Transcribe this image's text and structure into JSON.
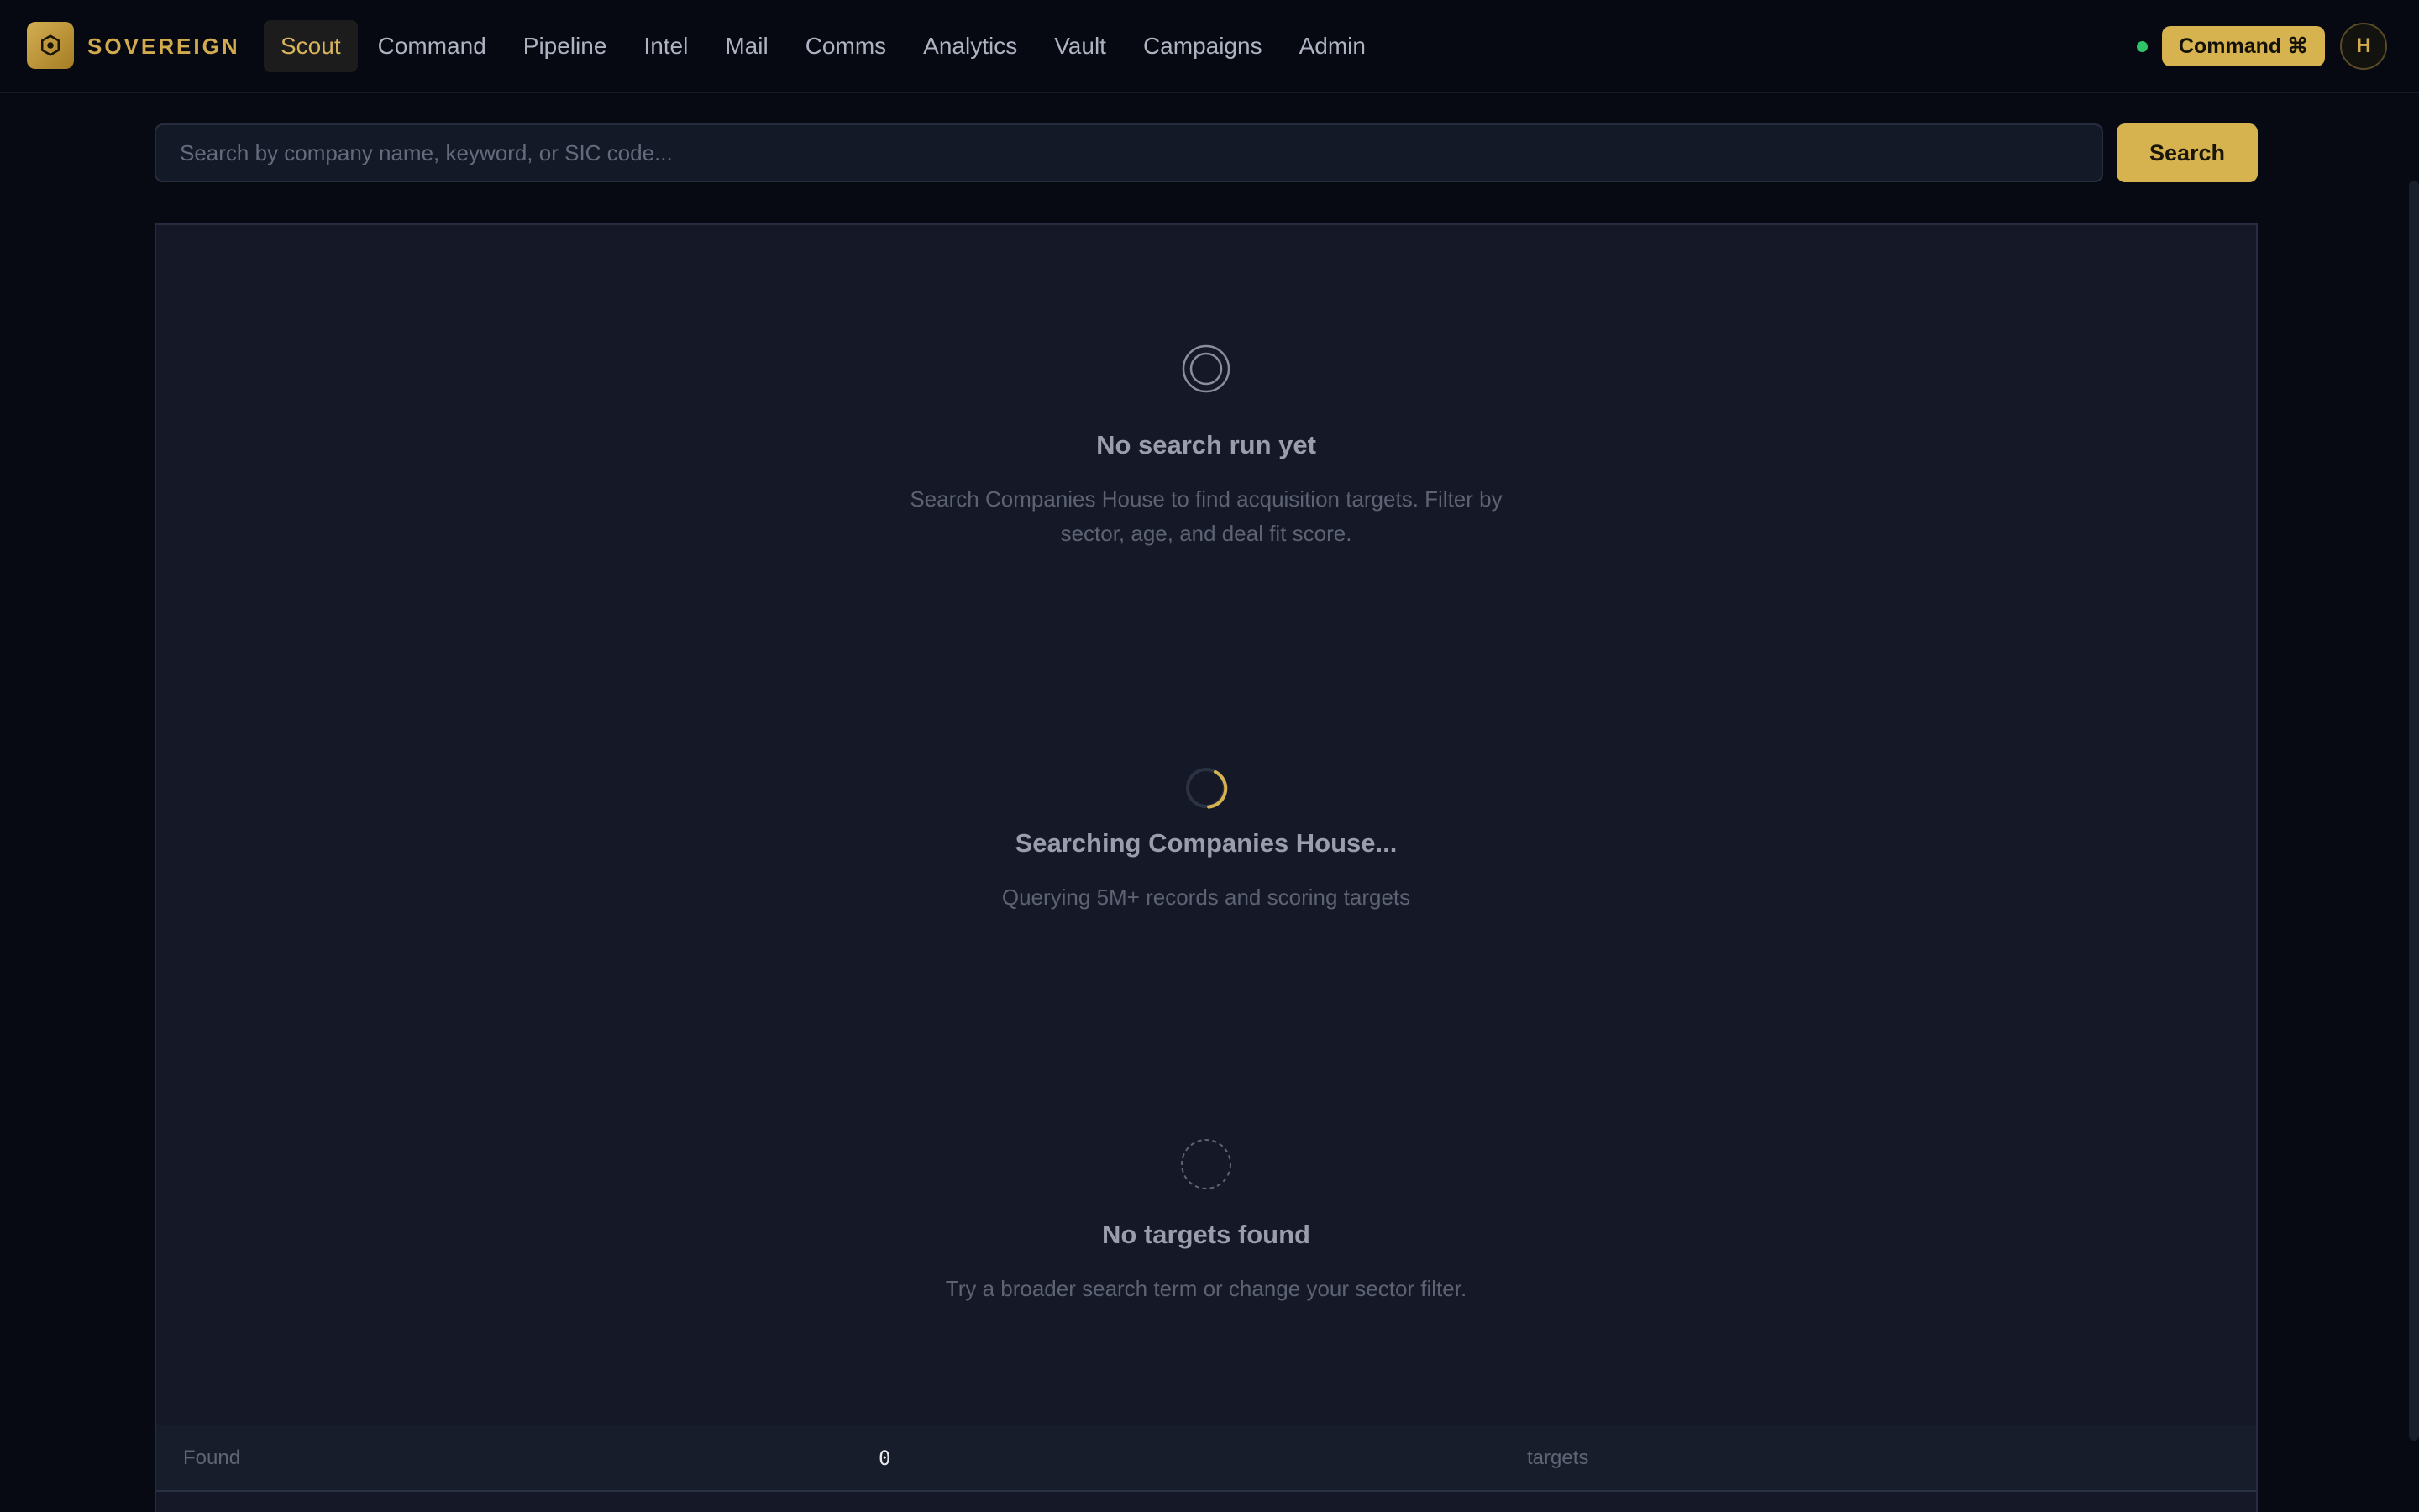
{
  "brand": {
    "name": "SOVEREIGN",
    "logo_icon": "hexagon-logo-icon",
    "accent_color": "#d6b34f"
  },
  "nav": {
    "items": [
      {
        "label": "Scout",
        "active": true
      },
      {
        "label": "Command",
        "active": false
      },
      {
        "label": "Pipeline",
        "active": false
      },
      {
        "label": "Intel",
        "active": false
      },
      {
        "label": "Mail",
        "active": false
      },
      {
        "label": "Comms",
        "active": false
      },
      {
        "label": "Analytics",
        "active": false
      },
      {
        "label": "Vault",
        "active": false
      },
      {
        "label": "Campaigns",
        "active": false
      },
      {
        "label": "Admin",
        "active": false
      }
    ]
  },
  "header": {
    "status_color": "#2fc466",
    "command_label": "Command ⌘",
    "avatar_initial": "H"
  },
  "search": {
    "placeholder": "Search by company name, keyword, or SIC code...",
    "value": "",
    "button_label": "Search"
  },
  "states": {
    "empty": {
      "icon": "target-icon",
      "title": "No search run yet",
      "description": "Search Companies House to find acquisition targets. Filter by sector, age, and deal fit score."
    },
    "loading": {
      "icon": "spinner-icon",
      "title": "Searching Companies House...",
      "description": "Querying 5M+ records and scoring targets"
    },
    "no_results": {
      "icon": "dashed-circle-icon",
      "title": "No targets found",
      "description": "Try a broader search term or change your sector filter."
    }
  },
  "results_footer": {
    "label": "Found",
    "count": "0",
    "unit": "targets"
  }
}
